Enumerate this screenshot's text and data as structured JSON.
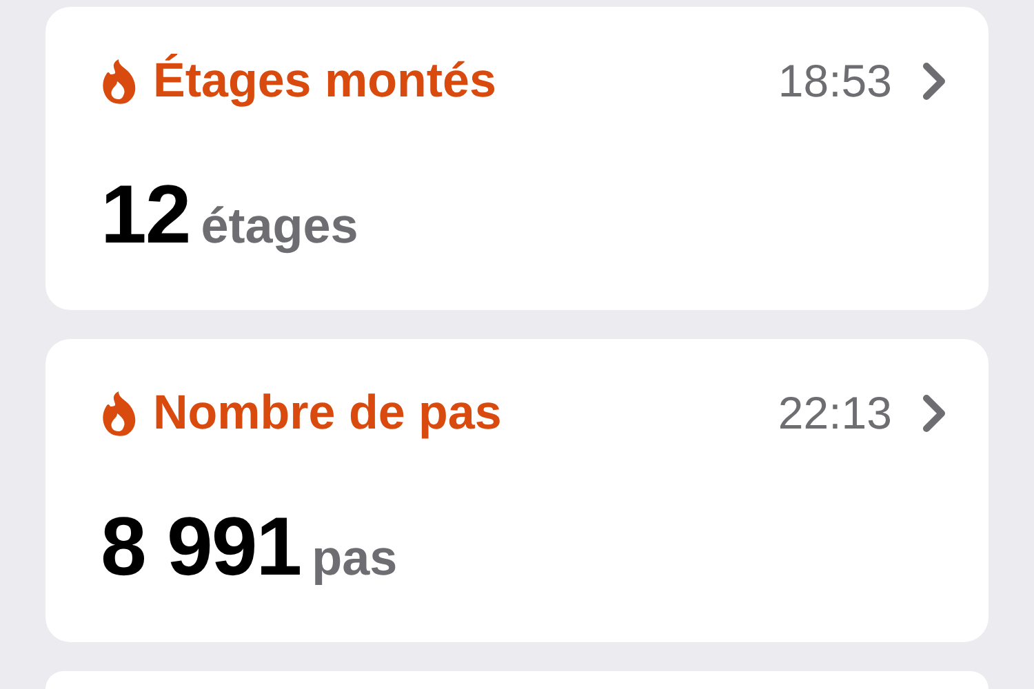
{
  "cards": [
    {
      "title": "Étages montés",
      "time": "18:53",
      "value": "12",
      "unit": "étages"
    },
    {
      "title": "Nombre de pas",
      "time": "22:13",
      "value": "8 991",
      "unit": "pas"
    }
  ]
}
